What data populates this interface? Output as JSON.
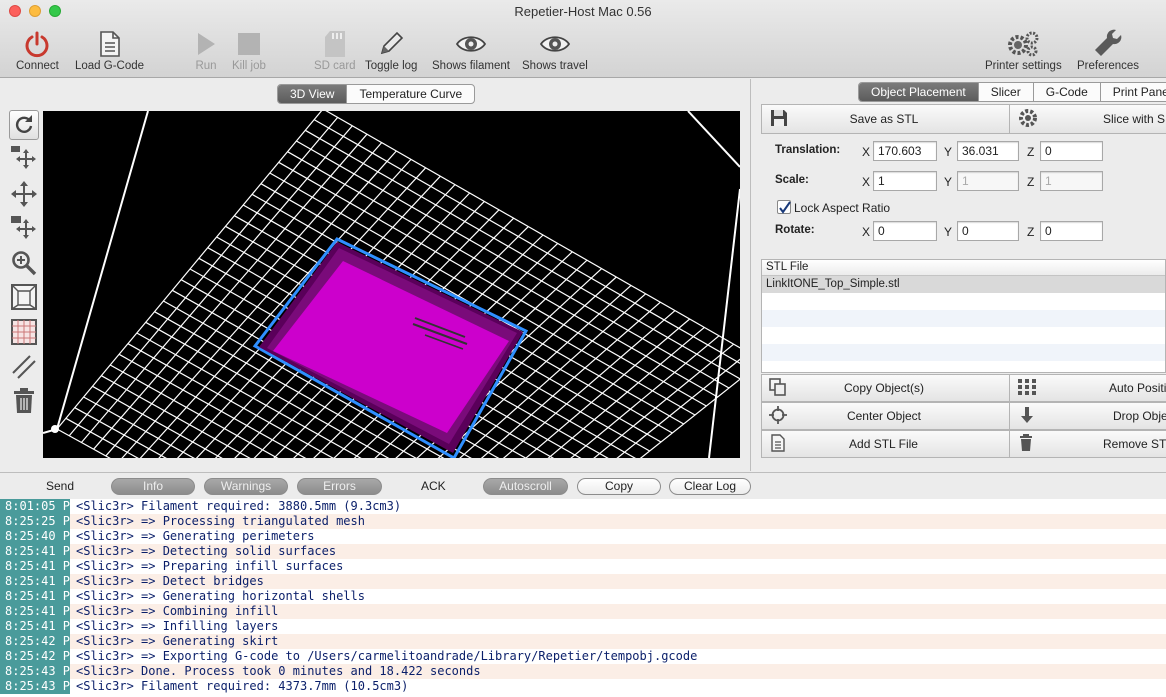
{
  "window": {
    "title": "Repetier-Host Mac 0.56"
  },
  "toolbar": {
    "connect": "Connect",
    "load_gcode": "Load G-Code",
    "run": "Run",
    "kill_job": "Kill job",
    "sd_card": "SD card",
    "toggle_log": "Toggle log",
    "shows_filament": "Shows filament",
    "shows_travel": "Shows travel",
    "printer_settings": "Printer settings",
    "preferences": "Preferences"
  },
  "view_tabs": {
    "tab_3d": "3D View",
    "tab_temp": "Temperature Curve"
  },
  "right_tabs": {
    "placement": "Object Placement",
    "slicer": "Slicer",
    "gcode": "G-Code",
    "print_panel": "Print Panel"
  },
  "object_placement": {
    "save_stl": "Save as STL",
    "slice_with": "Slice with S",
    "translation_label": "Translation:",
    "scale_label": "Scale:",
    "rotate_label": "Rotate:",
    "x": "X",
    "y": "Y",
    "z": "Z",
    "translation": {
      "x": "170.603",
      "y": "36.031",
      "z": "0"
    },
    "scale": {
      "x": "1",
      "y": "1",
      "z": "1"
    },
    "rotate": {
      "x": "0",
      "y": "0",
      "z": "0"
    },
    "lock_aspect": "Lock Aspect Ratio",
    "stl_header": "STL File",
    "stl_files": [
      "LinkItONE_Top_Simple.stl"
    ],
    "copy_objects": "Copy Object(s)",
    "auto_position": "Auto Positi",
    "center_object": "Center Object",
    "drop_object": "Drop Obje",
    "add_stl": "Add STL File",
    "remove_stl": "Remove STL"
  },
  "logbar": {
    "send": "Send",
    "info": "Info",
    "warnings": "Warnings",
    "errors": "Errors",
    "ack": "ACK",
    "autoscroll": "Autoscroll",
    "copy": "Copy",
    "clear_log": "Clear Log"
  },
  "log": [
    {
      "time": "8:01:05 P",
      "msg": "<Slic3r> Filament required: 3880.5mm (9.3cm3)"
    },
    {
      "time": "8:25:25 P",
      "msg": "<Slic3r> => Processing triangulated mesh"
    },
    {
      "time": "8:25:40 P",
      "msg": "<Slic3r> => Generating perimeters"
    },
    {
      "time": "8:25:41 P",
      "msg": "<Slic3r> => Detecting solid surfaces"
    },
    {
      "time": "8:25:41 P",
      "msg": "<Slic3r> => Preparing infill surfaces"
    },
    {
      "time": "8:25:41 P",
      "msg": "<Slic3r> => Detect bridges"
    },
    {
      "time": "8:25:41 P",
      "msg": "<Slic3r> => Generating horizontal shells"
    },
    {
      "time": "8:25:41 P",
      "msg": "<Slic3r> => Combining infill"
    },
    {
      "time": "8:25:41 P",
      "msg": "<Slic3r> => Infilling layers"
    },
    {
      "time": "8:25:42 P",
      "msg": "<Slic3r> => Generating skirt"
    },
    {
      "time": "8:25:42 P",
      "msg": "<Slic3r> => Exporting G-code to /Users/carmelitoandrade/Library/Repetier/tempobj.gcode"
    },
    {
      "time": "8:25:43 P",
      "msg": "<Slic3r> Done. Process took 0 minutes and 18.422 seconds"
    },
    {
      "time": "8:25:43 P",
      "msg": "<Slic3r> Filament required: 4373.7mm (10.5cm3)"
    }
  ],
  "colors": {
    "object": "#cc00cc",
    "selection": "#2f8fff",
    "log_time_bg": "#4a9b9b"
  }
}
